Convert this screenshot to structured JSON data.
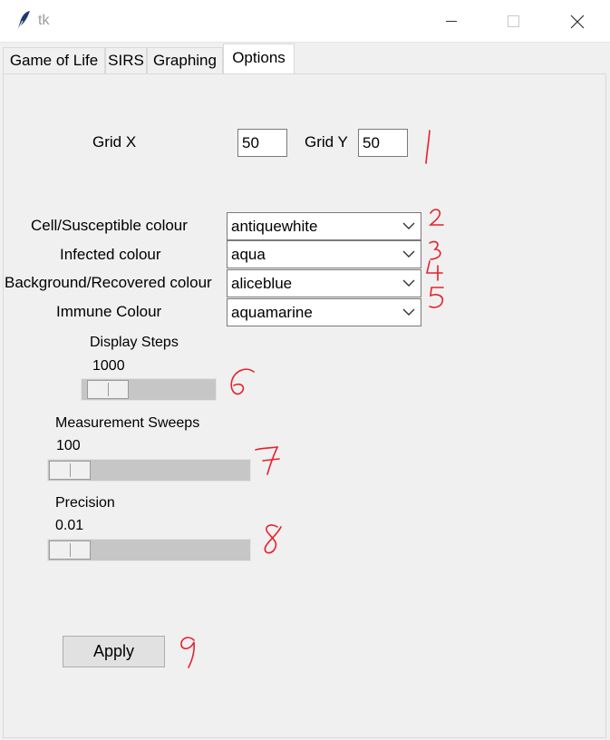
{
  "window": {
    "title": "tk"
  },
  "tabs": [
    {
      "label": "Game of Life"
    },
    {
      "label": "SIRS"
    },
    {
      "label": "Graphing"
    },
    {
      "label": "Options"
    }
  ],
  "options": {
    "grid_x_label": "Grid X",
    "grid_x_value": "50",
    "grid_y_label": "Grid Y",
    "grid_y_value": "50",
    "colours": [
      {
        "label": "Cell/Susceptible colour",
        "value": "antiquewhite"
      },
      {
        "label": "Infected colour",
        "value": "aqua"
      },
      {
        "label": "Background/Recovered colour",
        "value": "aliceblue"
      },
      {
        "label": "Immune Colour",
        "value": "aquamarine"
      }
    ],
    "display_steps": {
      "label": "Display Steps",
      "value": "1000"
    },
    "measurement_sweeps": {
      "label": "Measurement Sweeps",
      "value": "100"
    },
    "precision": {
      "label": "Precision",
      "value": "0.01"
    },
    "apply_label": "Apply"
  },
  "annotations": [
    "1",
    "2",
    "3",
    "4",
    "5",
    "6",
    "7",
    "8",
    "9"
  ],
  "colors": {
    "annotation_ink": "#e8202a",
    "trough": "#c6c6c6"
  },
  "icons": [
    "feather-icon",
    "minimize-icon",
    "maximize-icon",
    "close-icon",
    "chevron-down-icon"
  ]
}
